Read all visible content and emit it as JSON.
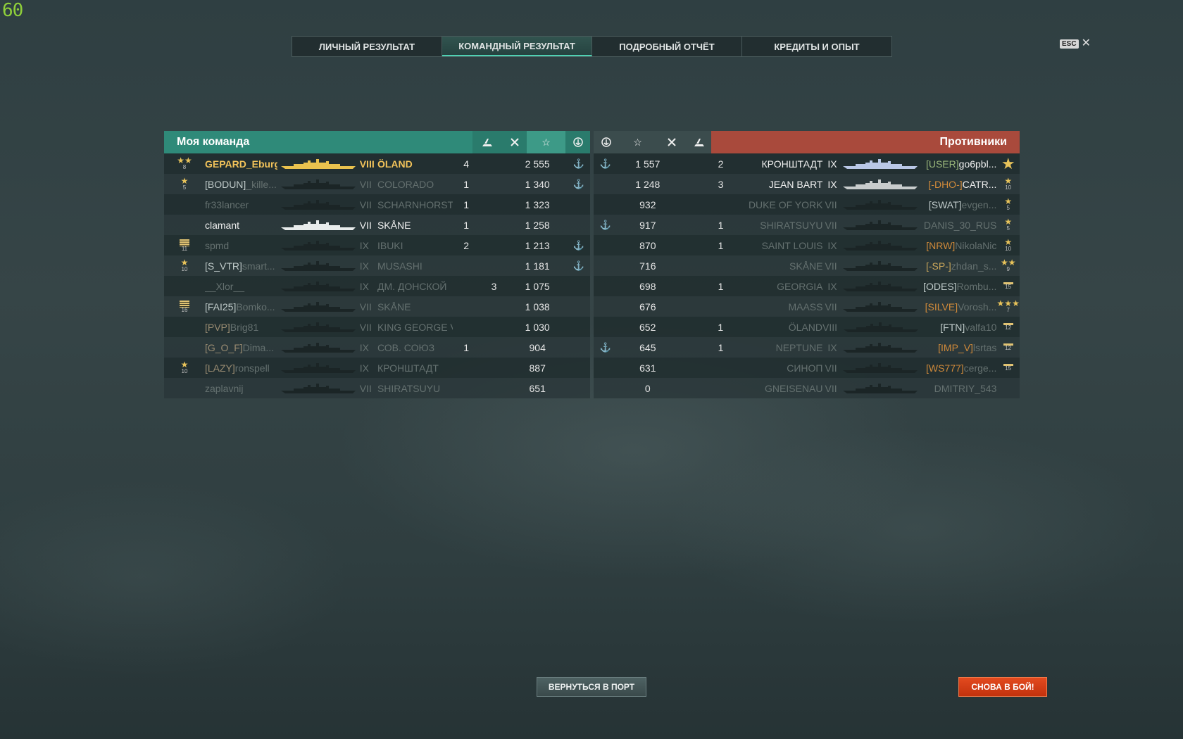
{
  "fps": "60",
  "tabs": [
    {
      "label": "ЛИЧНЫЙ РЕЗУЛЬТАТ"
    },
    {
      "label": "КОМАНДНЫЙ РЕЗУЛЬТАТ",
      "active": true
    },
    {
      "label": "ПОДРОБНЫЙ ОТЧЁТ"
    },
    {
      "label": "КРЕДИТЫ И ОПЫТ"
    }
  ],
  "esc": {
    "key": "ESC",
    "close": "✕"
  },
  "my_team": {
    "title": "Моя команда",
    "color": "#2f8a79",
    "header_icons": [
      "ship-kill-icon",
      "plane-kill-icon",
      "xp-star-icon",
      "base-capture-icon"
    ],
    "players": [
      {
        "medal": {
          "type": "stars",
          "stars": "★★",
          "level": "8"
        },
        "clan": "",
        "name": "GEPARD_Eburg",
        "style": "gold",
        "tier": "VIII",
        "ship": "ÖLAND",
        "kills": "4",
        "planes": "",
        "xp": "2 555",
        "capture": true,
        "ship_color": "#e9c24e"
      },
      {
        "medal": {
          "type": "stars",
          "stars": "★",
          "level": "5"
        },
        "clan": "[BODUN]",
        "clan_style": "",
        "name": "_kille...",
        "style": "dim",
        "tier": "VII",
        "ship": "COLORADO",
        "kills": "1",
        "planes": "",
        "xp": "1 340",
        "capture": true,
        "ship_color": "#1b2526"
      },
      {
        "medal": null,
        "clan": "",
        "name": "fr33lancer",
        "style": "dim",
        "tier": "VII",
        "ship": "SCHARNHORST",
        "kills": "1",
        "planes": "",
        "xp": "1 323",
        "capture": false,
        "ship_color": "#1b2526"
      },
      {
        "medal": null,
        "clan": "",
        "name": "clamant",
        "style": "white",
        "tier": "VII",
        "ship": "SKÅNE",
        "kills": "1",
        "planes": "",
        "xp": "1 258",
        "capture": false,
        "ship_color": "#e8ecec"
      },
      {
        "medal": {
          "type": "bars",
          "level": "11"
        },
        "clan": "",
        "name": "spmd",
        "style": "dim",
        "tier": "IX",
        "ship": "IBUKI",
        "kills": "2",
        "planes": "",
        "xp": "1 213",
        "capture": true,
        "ship_color": "#1b2526"
      },
      {
        "medal": {
          "type": "stars",
          "stars": "★",
          "level": "10"
        },
        "clan": "[S_VTR]",
        "clan_style": "",
        "name": "smart...",
        "style": "dim",
        "tier": "IX",
        "ship": "MUSASHI",
        "kills": "",
        "planes": "",
        "xp": "1 181",
        "capture": true,
        "ship_color": "#1b2526"
      },
      {
        "medal": null,
        "clan": "",
        "name": "__Xlor__",
        "style": "dim",
        "tier": "IX",
        "ship": "ДМ. ДОНСКОЙ",
        "kills": "",
        "planes": "3",
        "xp": "1 075",
        "capture": false,
        "ship_color": "#1b2526"
      },
      {
        "medal": {
          "type": "bars",
          "level": "16"
        },
        "clan": "[FAI25]",
        "clan_style": "",
        "name": "Bomko...",
        "style": "dim",
        "tier": "VII",
        "ship": "SKÅNE",
        "kills": "",
        "planes": "",
        "xp": "1 038",
        "capture": false,
        "ship_color": "#1b2526"
      },
      {
        "medal": null,
        "clan": "[PVP]",
        "clan_style": "dimc",
        "name": "Brig81",
        "style": "dim",
        "tier": "VII",
        "ship": "KING GEORGE V",
        "kills": "",
        "planes": "",
        "xp": "1 030",
        "capture": false,
        "ship_color": "#1b2526"
      },
      {
        "medal": null,
        "clan": "[G_O_F]",
        "clan_style": "dimc",
        "name": "Dima...",
        "style": "dim",
        "tier": "IX",
        "ship": "СОВ. СОЮЗ",
        "kills": "1",
        "planes": "",
        "xp": "904",
        "capture": false,
        "ship_color": "#1b2526"
      },
      {
        "medal": {
          "type": "stars",
          "stars": "★",
          "level": "10"
        },
        "clan": "[LAZY]",
        "clan_style": "dimc",
        "name": "ronspell",
        "style": "dim",
        "tier": "IX",
        "ship": "КРОНШТАДТ",
        "kills": "",
        "planes": "",
        "xp": "887",
        "capture": false,
        "ship_color": "#1b2526"
      },
      {
        "medal": null,
        "clan": "",
        "name": "zaplavnij",
        "style": "dim",
        "tier": "VII",
        "ship": "SHIRATSUYU",
        "kills": "",
        "planes": "",
        "xp": "651",
        "capture": false,
        "ship_color": "#1b2526"
      }
    ]
  },
  "enemy_team": {
    "title": "Противники",
    "color": "#a94a3c",
    "header_icons": [
      "base-capture-icon",
      "xp-star-icon",
      "plane-kill-icon",
      "ship-kill-icon"
    ],
    "players": [
      {
        "capture": true,
        "xp": "1 557",
        "planes": "",
        "kills": "2",
        "ship": "КРОНШТАДТ",
        "tier": "IX",
        "style": "white",
        "clan": "[USER]",
        "clan_style": "grn",
        "name": "go6pbl...",
        "name_style": "white",
        "medal": {
          "type": "big-star",
          "stars": "★",
          "level": ""
        },
        "ship_color": "#b9c7e6"
      },
      {
        "capture": false,
        "xp": "1 248",
        "planes": "",
        "kills": "3",
        "ship": "JEAN BART",
        "tier": "IX",
        "style": "white",
        "clan": "[-DHO-]",
        "clan_style": "org",
        "name": "CATR...",
        "name_style": "white",
        "medal": {
          "type": "stars",
          "stars": "★",
          "level": "10"
        },
        "ship_color": "#c8cccc"
      },
      {
        "capture": false,
        "xp": "932",
        "planes": "",
        "kills": "",
        "ship": "DUKE OF YORK",
        "tier": "VII",
        "style": "dim",
        "clan": "[SWAT]",
        "clan_style": "",
        "name": "evgen...",
        "name_style": "dim",
        "medal": {
          "type": "stars",
          "stars": "★",
          "level": "5"
        },
        "ship_color": "#1b2526"
      },
      {
        "capture": true,
        "xp": "917",
        "planes": "",
        "kills": "1",
        "ship": "SHIRATSUYU",
        "tier": "VII",
        "style": "dim",
        "clan": "",
        "clan_style": "",
        "name": "DANIS_30_RUS",
        "name_style": "dim",
        "medal": {
          "type": "stars",
          "stars": "★",
          "level": "5"
        },
        "ship_color": "#1b2526"
      },
      {
        "capture": false,
        "xp": "870",
        "planes": "",
        "kills": "1",
        "ship": "SAINT LOUIS",
        "tier": "IX",
        "style": "dim",
        "clan": "[NRW]",
        "clan_style": "org",
        "name": "NikolaNic",
        "name_style": "dim",
        "medal": {
          "type": "stars",
          "stars": "★",
          "level": "10"
        },
        "ship_color": "#1b2526"
      },
      {
        "capture": false,
        "xp": "716",
        "planes": "",
        "kills": "",
        "ship": "SKÅNE",
        "tier": "VII",
        "style": "dim",
        "clan": "[-SP-]",
        "clan_style": "ylw",
        "name": "zhdan_s...",
        "name_style": "dim",
        "medal": {
          "type": "stars",
          "stars": "★★",
          "level": "9"
        },
        "ship_color": "#1b2526"
      },
      {
        "capture": false,
        "xp": "698",
        "planes": "",
        "kills": "1",
        "ship": "GEORGIA",
        "tier": "IX",
        "style": "dim",
        "clan": "[ODES]",
        "clan_style": "",
        "name": "Rombu...",
        "name_style": "dim",
        "medal": {
          "type": "bar",
          "level": "15"
        },
        "ship_color": "#1b2526"
      },
      {
        "capture": false,
        "xp": "676",
        "planes": "",
        "kills": "",
        "ship": "MAASS",
        "tier": "VII",
        "style": "dim",
        "clan": "[SILVE]",
        "clan_style": "org",
        "name": "Vorosh...",
        "name_style": "dim",
        "medal": {
          "type": "stars",
          "stars": "★★★",
          "level": "7"
        },
        "ship_color": "#1b2526"
      },
      {
        "capture": false,
        "xp": "652",
        "planes": "",
        "kills": "1",
        "ship": "ÖLAND",
        "tier": "VIII",
        "style": "dim",
        "clan": "[FTN]",
        "clan_style": "",
        "name": "valfa10",
        "name_style": "dim",
        "medal": {
          "type": "bar",
          "level": "12"
        },
        "ship_color": "#1b2526"
      },
      {
        "capture": true,
        "xp": "645",
        "planes": "",
        "kills": "1",
        "ship": "NEPTUNE",
        "tier": "IX",
        "style": "dim",
        "clan": "[IMP_V]",
        "clan_style": "org",
        "name": "lsrtas",
        "name_style": "dim",
        "medal": {
          "type": "bar",
          "level": "12"
        },
        "ship_color": "#1b2526"
      },
      {
        "capture": false,
        "xp": "631",
        "planes": "",
        "kills": "",
        "ship": "СИНОП",
        "tier": "VII",
        "style": "dim",
        "clan": "[WS777]",
        "clan_style": "org",
        "name": "cerge...",
        "name_style": "dim",
        "medal": {
          "type": "bar",
          "level": "15"
        },
        "ship_color": "#1b2526"
      },
      {
        "capture": false,
        "xp": "0",
        "planes": "",
        "kills": "",
        "ship": "GNEISENAU",
        "tier": "VII",
        "style": "dim",
        "clan": "",
        "clan_style": "",
        "name": "DMITRIY_543",
        "name_style": "dim",
        "medal": null,
        "ship_color": "#1b2526"
      }
    ]
  },
  "buttons": {
    "port": "ВЕРНУТЬСЯ В ПОРТ",
    "battle": "СНОВА В БОЙ!"
  }
}
